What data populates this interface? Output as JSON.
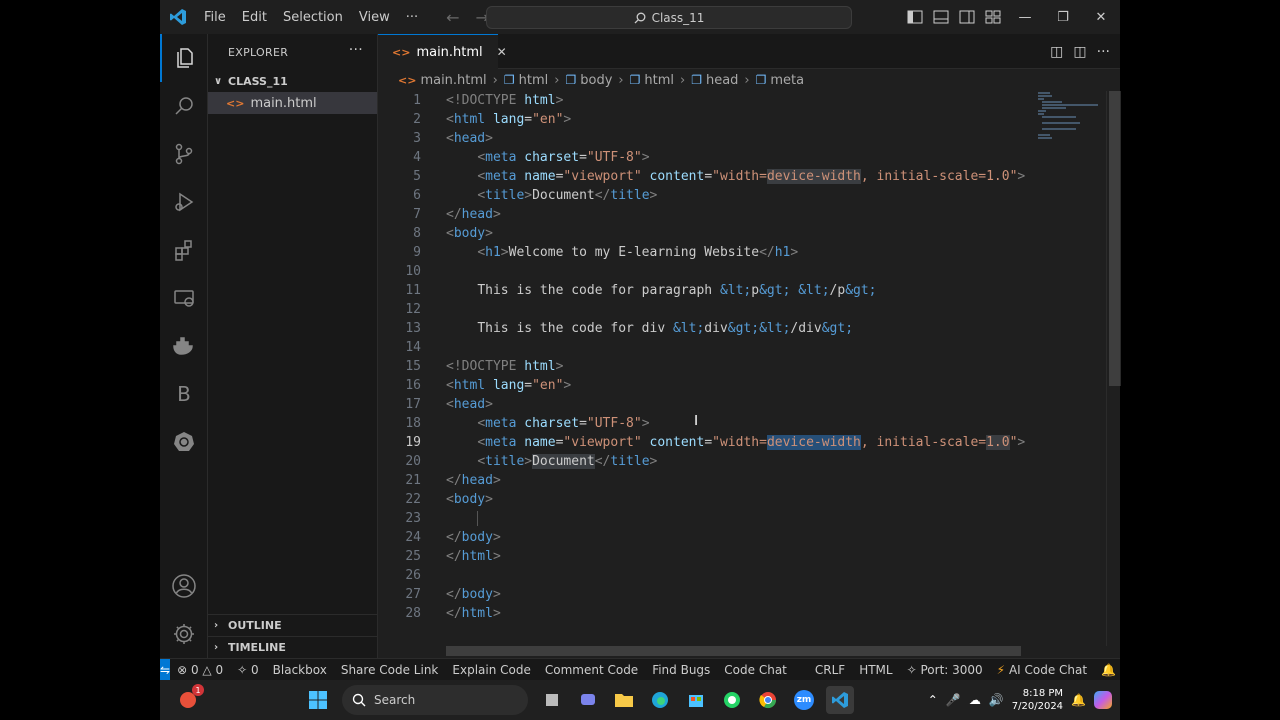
{
  "window": {
    "menu": [
      "File",
      "Edit",
      "Selection",
      "View"
    ],
    "more_menu": "···",
    "search_text": "Class_11"
  },
  "sidebar": {
    "title": "EXPLORER",
    "folder": "CLASS_11",
    "file": "main.html",
    "outline": "OUTLINE",
    "timeline": "TIMELINE"
  },
  "editor": {
    "tab_label": "main.html",
    "breadcrumb": [
      "main.html",
      "html",
      "body",
      "html",
      "head",
      "meta"
    ]
  },
  "code": {
    "lines": [
      {
        "n": "1"
      },
      {
        "n": "2"
      },
      {
        "n": "3"
      },
      {
        "n": "4"
      },
      {
        "n": "5"
      },
      {
        "n": "6"
      },
      {
        "n": "7"
      },
      {
        "n": "8"
      },
      {
        "n": "9"
      },
      {
        "n": "10"
      },
      {
        "n": "11"
      },
      {
        "n": "12"
      },
      {
        "n": "13"
      },
      {
        "n": "14"
      },
      {
        "n": "15"
      },
      {
        "n": "16"
      },
      {
        "n": "17"
      },
      {
        "n": "18"
      },
      {
        "n": "19"
      },
      {
        "n": "20"
      },
      {
        "n": "21"
      },
      {
        "n": "22"
      },
      {
        "n": "23"
      },
      {
        "n": "24"
      },
      {
        "n": "25"
      },
      {
        "n": "26"
      },
      {
        "n": "27"
      },
      {
        "n": "28"
      }
    ],
    "current_line": 19,
    "tokens": {
      "doctype": "<!DOCTYPE",
      "html": "html",
      "lang": "lang",
      "en": "\"en\"",
      "head": "head",
      "meta": "meta",
      "charset": "charset",
      "utf8": "\"UTF-8\"",
      "name": "name",
      "viewport": "\"viewport\"",
      "content": "content",
      "content_val_a": "\"width=",
      "content_val_b": "device-width",
      "content_val_c": ", initial-scale=",
      "content_val_d": "1.0",
      "content_val_e": "\"",
      "title": "title",
      "document": "Document",
      "body": "body",
      "h1": "h1",
      "welcome": "Welcome to my E-learning Website",
      "para_text": "This is the code for paragraph ",
      "para_ent_1": "&lt;",
      "para_p": "p",
      "para_ent_2": "&gt;",
      "para_ent_3": "&lt;",
      "para_slash_p": "/p",
      "para_ent_4": "&gt;",
      "div_text": "This is the code for div ",
      "div_ent_1": "&lt;",
      "div_div": "div",
      "div_ent_2": "&gt;&lt;",
      "div_slash_div": "/div",
      "div_ent_3": "&gt;"
    }
  },
  "statusbar": {
    "errors": "0",
    "warnings": "0",
    "ports_count": "0",
    "items": [
      "Blackbox",
      "Share Code Link",
      "Explain Code",
      "Comment Code",
      "Find Bugs",
      "Code Chat"
    ],
    "eol": "CRLF",
    "language": "HTML",
    "port": "Port: 3000",
    "ai_chat": "AI Code Chat"
  },
  "taskbar": {
    "search_label": "Search",
    "time": "8:18 PM",
    "date": "7/20/2024",
    "zoom_label": "zm",
    "notification_badge": "1"
  },
  "colors": {
    "accent": "#0078d4",
    "tag": "#569cd6",
    "attribute": "#9cdcfe",
    "string": "#ce9178",
    "selection": "#264f78"
  }
}
